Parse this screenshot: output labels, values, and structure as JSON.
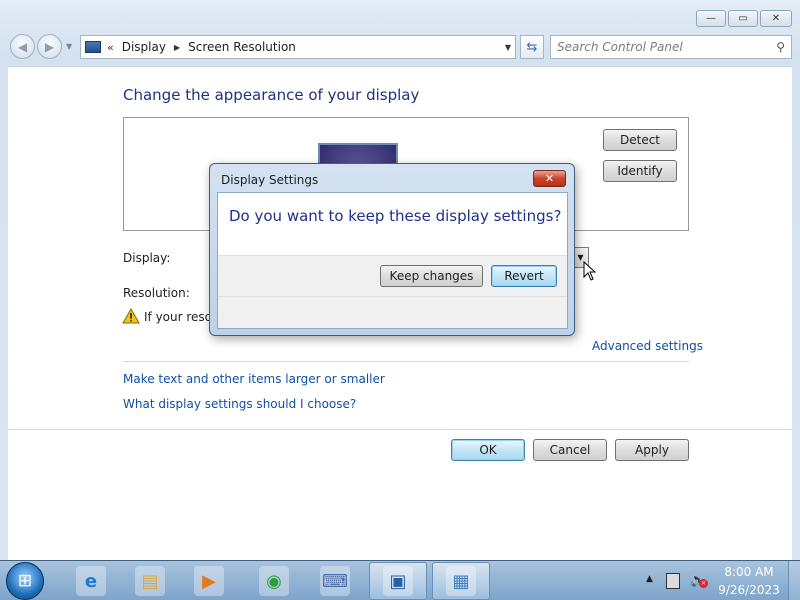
{
  "window": {
    "caption_buttons": {
      "minimize": "—",
      "maximize": "▭",
      "close": "✕"
    }
  },
  "navigation": {
    "breadcrumb_chevron": "«",
    "breadcrumb": [
      "Display",
      "Screen Resolution"
    ],
    "search_placeholder": "Search Control Panel"
  },
  "page": {
    "title": "Change the appearance of your display",
    "detect_label": "Detect",
    "identify_label": "Identify",
    "display_label": "Display:",
    "resolution_label": "Resolution:",
    "warning_text": "If your resolu",
    "advanced_settings_link": "Advanced settings",
    "links": [
      "Make text and other items larger or smaller",
      "What display settings should I choose?"
    ],
    "ok_label": "OK",
    "cancel_label": "Cancel",
    "apply_label": "Apply"
  },
  "dialog": {
    "title": "Display Settings",
    "message": "Do you want to keep these display settings?",
    "keep_label": "Keep changes",
    "revert_label": "Revert"
  },
  "taskbar": {
    "items": [
      {
        "name": "internet-explorer-icon",
        "glyph": "e",
        "color": "#1f78d1"
      },
      {
        "name": "file-explorer-icon",
        "glyph": "▤",
        "color": "#d9a93b"
      },
      {
        "name": "media-player-icon",
        "glyph": "▶",
        "color": "#e07b1c"
      },
      {
        "name": "chrome-icon",
        "glyph": "◉",
        "color": "#2e9e44"
      },
      {
        "name": "keyboard-icon",
        "glyph": "⌨",
        "color": "#4a6ea8"
      },
      {
        "name": "display-window-icon",
        "glyph": "▣",
        "color": "#2a5fa8"
      },
      {
        "name": "control-panel-icon",
        "glyph": "▦",
        "color": "#3b7fc4"
      }
    ],
    "clock_time": "8:00 AM",
    "clock_date": "9/26/2023"
  }
}
